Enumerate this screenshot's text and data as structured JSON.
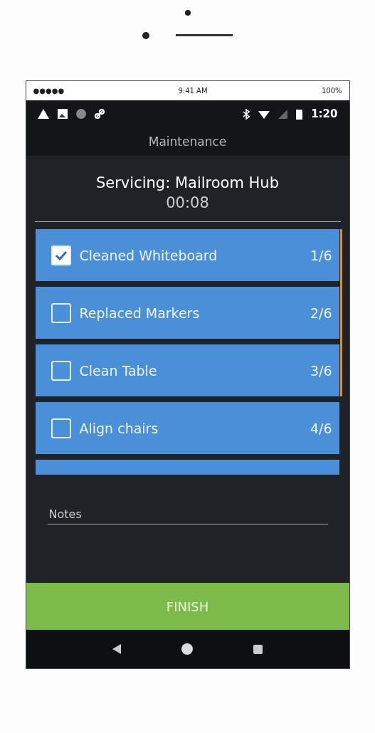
{
  "ios_status_bar": {
    "carrier": "●●●●● ",
    "time": "9:41 AM",
    "battery": "100%"
  },
  "android_status_bar": {
    "time": "1:20"
  },
  "app_bar": {
    "title": "Maintenance"
  },
  "header": {
    "title": "Servicing: Mailroom Hub",
    "timer": "00:08"
  },
  "tasks": [
    {
      "label": "Cleaned Whiteboard",
      "count": "1/6",
      "checked": true
    },
    {
      "label": "Replaced Markers",
      "count": "2/6",
      "checked": false
    },
    {
      "label": "Clean Table",
      "count": "3/6",
      "checked": false
    },
    {
      "label": "Align chairs",
      "count": "4/6",
      "checked": false
    }
  ],
  "notes": {
    "placeholder": "Notes"
  },
  "finish_button": {
    "label": "FINISH"
  }
}
